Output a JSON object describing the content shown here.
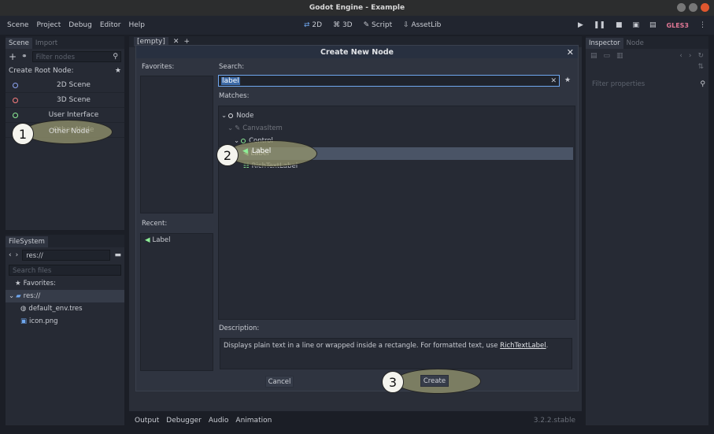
{
  "window": {
    "title": "Godot Engine - Example"
  },
  "menu": [
    "Scene",
    "Project",
    "Debug",
    "Editor",
    "Help"
  ],
  "workspaces": [
    "2D",
    "3D",
    "Script",
    "AssetLib"
  ],
  "renderer": "GLES3",
  "scene_dock": {
    "tabs": [
      "Scene",
      "Import"
    ],
    "filter_placeholder": "Filter nodes",
    "create_root_label": "Create Root Node:",
    "items": [
      "2D Scene",
      "3D Scene",
      "User Interface",
      "Other Node"
    ]
  },
  "filesystem_dock": {
    "tab": "FileSystem",
    "path": "res://",
    "search_placeholder": "Search files",
    "favorites_label": "Favorites:",
    "root": "res://",
    "files": [
      "default_env.tres",
      "icon.png"
    ]
  },
  "editor_tab": "[empty]",
  "inspector": {
    "tabs": [
      "Inspector",
      "Node"
    ],
    "filter_placeholder": "Filter properties"
  },
  "bottom_panel": {
    "tabs": [
      "Output",
      "Debugger",
      "Audio",
      "Animation"
    ],
    "version": "3.2.2.stable"
  },
  "dialog": {
    "title": "Create New Node",
    "favorites_label": "Favorites:",
    "recent_label": "Recent:",
    "recent_items": [
      "Label"
    ],
    "search_label": "Search:",
    "search_value": "label",
    "matches_label": "Matches:",
    "tree": [
      {
        "label": "Node",
        "depth": 0
      },
      {
        "label": "CanvasItem",
        "depth": 1,
        "dim": true
      },
      {
        "label": "Control",
        "depth": 2
      },
      {
        "label": "Label",
        "depth": 3,
        "selected": true
      },
      {
        "label": "RichTextLabel",
        "depth": 3
      }
    ],
    "description_label": "Description:",
    "description_text": "Displays plain text in a line or wrapped inside a rectangle. For formatted text, use ",
    "description_link": "RichTextLabel",
    "description_end": ".",
    "cancel_label": "Cancel",
    "create_label": "Create"
  },
  "callouts": [
    "1",
    "2",
    "3"
  ],
  "colors": {
    "accent": "#6fa7ef",
    "label_green": "#8eef97",
    "selection": "#4a5466"
  }
}
